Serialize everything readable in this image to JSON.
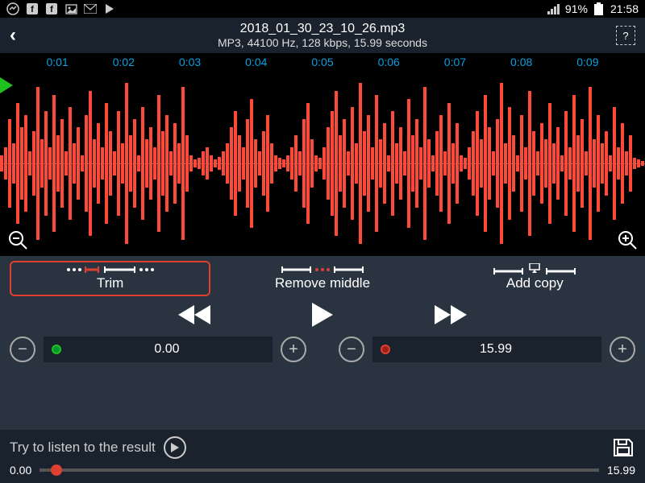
{
  "status": {
    "battery_pct": "91%",
    "time": "21:58"
  },
  "header": {
    "title": "2018_01_30_23_10_26.mp3",
    "info": "MP3, 44100 Hz, 128 kbps, 15.99 seconds",
    "help_label": "?"
  },
  "ruler": {
    "ticks": [
      "0:01",
      "0:02",
      "0:03",
      "0:04",
      "0:05",
      "0:06",
      "0:07",
      "0:08",
      "0:09"
    ]
  },
  "actions": {
    "trim": "Trim",
    "remove_middle": "Remove middle",
    "add_copy": "Add copy"
  },
  "markers": {
    "start_value": "0.00",
    "end_value": "15.99"
  },
  "footer": {
    "text": "Try to listen to the result",
    "pos": "0.00",
    "duration": "15.99"
  },
  "colors": {
    "accent_red": "#e04030",
    "accent_green": "#1fc01f",
    "tick_blue": "#0aa0e0"
  }
}
